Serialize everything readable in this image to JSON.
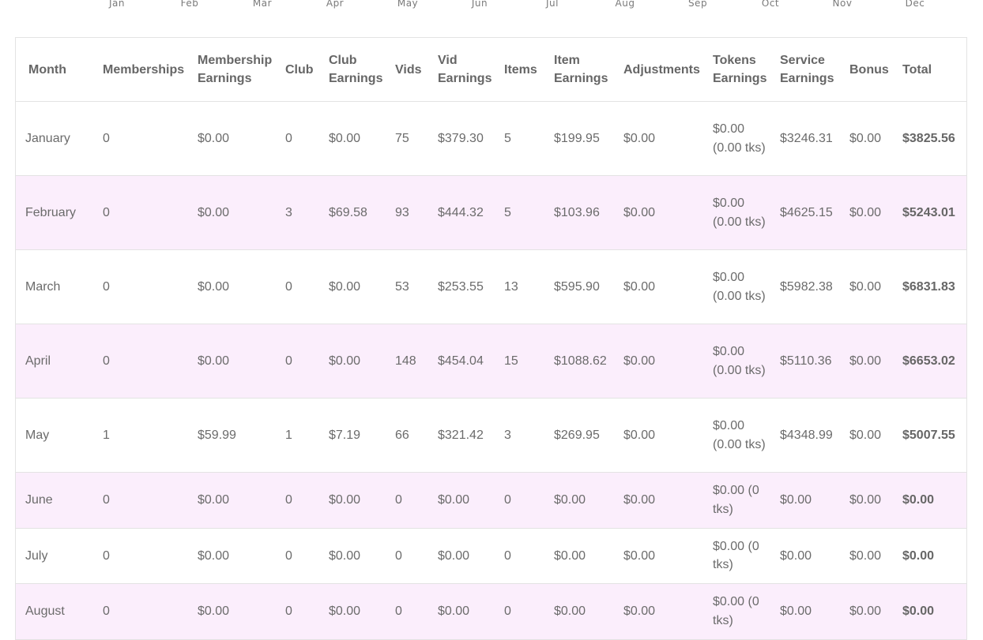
{
  "month_axis": [
    "Jan",
    "Feb",
    "Mar",
    "Apr",
    "May",
    "Jun",
    "Jul",
    "Aug",
    "Sep",
    "Oct",
    "Nov",
    "Dec"
  ],
  "table": {
    "headers": [
      "Month",
      "Memberships",
      "Membership Earnings",
      "Club",
      "Club Earnings",
      "Vids",
      "Vid Earnings",
      "Items",
      "Item Earnings",
      "Adjustments",
      "Tokens Earnings",
      "Service Earnings",
      "Bonus",
      "Total"
    ],
    "rows": [
      [
        "January",
        "0",
        "$0.00",
        "0",
        "$0.00",
        "75",
        "$379.30",
        "5",
        "$199.95",
        "$0.00",
        "$0.00 (0.00 tks)",
        "$3246.31",
        "$0.00",
        "$3825.56"
      ],
      [
        "February",
        "0",
        "$0.00",
        "3",
        "$69.58",
        "93",
        "$444.32",
        "5",
        "$103.96",
        "$0.00",
        "$0.00 (0.00 tks)",
        "$4625.15",
        "$0.00",
        "$5243.01"
      ],
      [
        "March",
        "0",
        "$0.00",
        "0",
        "$0.00",
        "53",
        "$253.55",
        "13",
        "$595.90",
        "$0.00",
        "$0.00 (0.00 tks)",
        "$5982.38",
        "$0.00",
        "$6831.83"
      ],
      [
        "April",
        "0",
        "$0.00",
        "0",
        "$0.00",
        "148",
        "$454.04",
        "15",
        "$1088.62",
        "$0.00",
        "$0.00 (0.00 tks)",
        "$5110.36",
        "$0.00",
        "$6653.02"
      ],
      [
        "May",
        "1",
        "$59.99",
        "1",
        "$7.19",
        "66",
        "$321.42",
        "3",
        "$269.95",
        "$0.00",
        "$0.00 (0.00 tks)",
        "$4348.99",
        "$0.00",
        "$5007.55"
      ],
      [
        "June",
        "0",
        "$0.00",
        "0",
        "$0.00",
        "0",
        "$0.00",
        "0",
        "$0.00",
        "$0.00",
        "$0.00 (0 tks)",
        "$0.00",
        "$0.00",
        "$0.00"
      ],
      [
        "July",
        "0",
        "$0.00",
        "0",
        "$0.00",
        "0",
        "$0.00",
        "0",
        "$0.00",
        "$0.00",
        "$0.00 (0 tks)",
        "$0.00",
        "$0.00",
        "$0.00"
      ],
      [
        "August",
        "0",
        "$0.00",
        "0",
        "$0.00",
        "0",
        "$0.00",
        "0",
        "$0.00",
        "$0.00",
        "$0.00 (0 tks)",
        "$0.00",
        "$0.00",
        "$0.00"
      ]
    ]
  },
  "colors": {
    "alt_row": "#fbeefc",
    "border": "#e3e3e3",
    "text": "#666666"
  }
}
